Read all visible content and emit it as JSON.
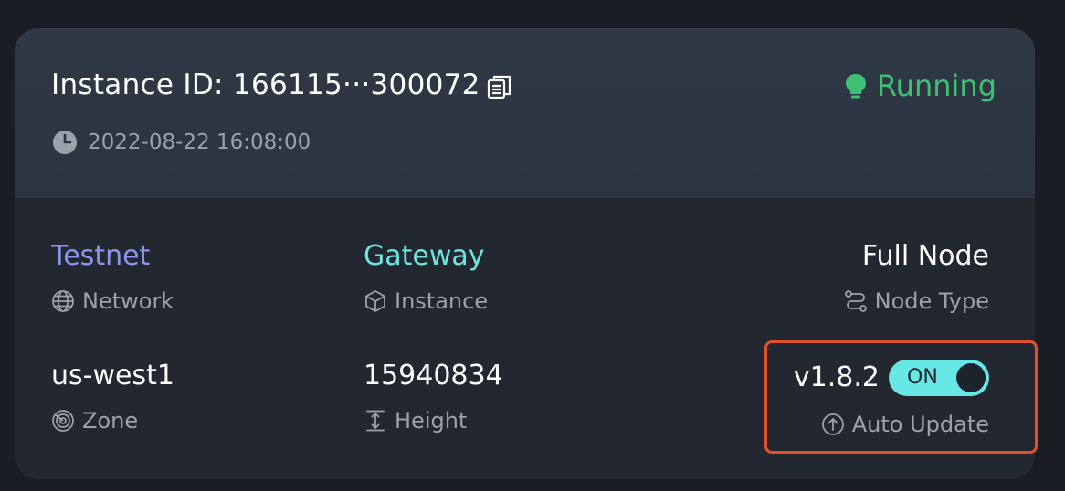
{
  "header": {
    "instance_title": "Instance ID: 166115···300072",
    "status": "Running",
    "timestamp": "2022-08-22 16:08:00"
  },
  "details": {
    "network": {
      "value": "Testnet",
      "label": "Network",
      "color": "#8b95ef"
    },
    "instance": {
      "value": "Gateway",
      "label": "Instance",
      "color": "#6de5df"
    },
    "node_type": {
      "value": "Full Node",
      "label": "Node Type"
    },
    "zone": {
      "value": "us-west1",
      "label": "Zone"
    },
    "height": {
      "value": "15940834",
      "label": "Height"
    },
    "auto_update": {
      "version": "v1.8.2",
      "toggle": "ON",
      "label": "Auto Update"
    }
  },
  "colors": {
    "status": "#3fbf73",
    "toggle": "#67e8e6",
    "highlight": "#e2512d"
  },
  "icons": [
    "copy-icon",
    "lightbulb-icon",
    "clock-icon",
    "globe-icon",
    "cube-icon",
    "node-route-icon",
    "radar-icon",
    "height-icon",
    "arrow-up-circle-icon"
  ]
}
